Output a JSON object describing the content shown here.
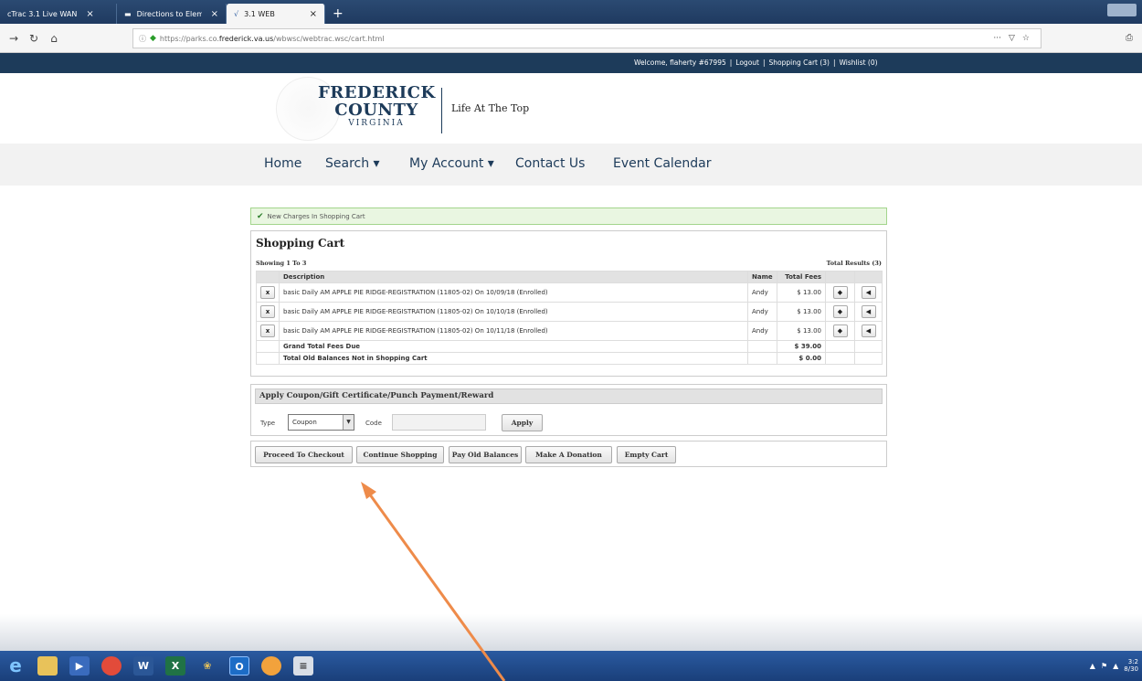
{
  "browser": {
    "tabs": [
      {
        "title": "cTrac 3.1 Live WAN"
      },
      {
        "title": "Directions to Elementary, Midd"
      },
      {
        "title": "3.1 WEB",
        "active": true
      }
    ],
    "url_prefix": "https://parks.co.",
    "url_domain": "frederick.va.us",
    "url_path": "/wbwsc/webtrac.wsc/cart.html",
    "more": "···"
  },
  "topbar": {
    "welcome": "Welcome, flaherty #67995",
    "logout": "Logout",
    "cart": "Shopping Cart (3)",
    "wishlist": "Wishlist (0)"
  },
  "brand": {
    "line1": "FREDERICK",
    "line2": "COUNTY",
    "line3": "VIRGINIA",
    "tagline": "Life At The Top"
  },
  "nav": {
    "home": "Home",
    "search": "Search ▾",
    "account": "My Account ▾",
    "contact": "Contact Us",
    "calendar": "Event Calendar"
  },
  "alert": "New Charges In Shopping Cart",
  "cart": {
    "title": "Shopping Cart",
    "showing": "Showing 1 To 3",
    "total_results": "Total Results (3)",
    "headers": {
      "description": "Description",
      "name": "Name",
      "fees": "Total Fees"
    },
    "rows": [
      {
        "remove": "x",
        "description": "basic Daily AM APPLE PIE RIDGE-REGISTRATION (11805-02) On 10/09/18 (Enrolled)",
        "name": "Andy",
        "fee": "$ 13.00"
      },
      {
        "remove": "x",
        "description": "basic Daily AM APPLE PIE RIDGE-REGISTRATION (11805-02) On 10/10/18 (Enrolled)",
        "name": "Andy",
        "fee": "$ 13.00"
      },
      {
        "remove": "x",
        "description": "basic Daily AM APPLE PIE RIDGE-REGISTRATION (11805-02) On 10/11/18 (Enrolled)",
        "name": "Andy",
        "fee": "$ 13.00"
      }
    ],
    "grand_total_label": "Grand Total Fees Due",
    "grand_total": "$ 39.00",
    "old_balance_label": "Total Old Balances Not in Shopping Cart",
    "old_balance": "$ 0.00"
  },
  "coupon": {
    "header": "Apply Coupon/Gift Certificate/Punch Payment/Reward",
    "type_label": "Type",
    "type_value": "Coupon",
    "code_label": "Code",
    "code_value": "",
    "apply": "Apply"
  },
  "actions": {
    "checkout": "Proceed To Checkout",
    "continue": "Continue Shopping",
    "pay_old": "Pay Old Balances",
    "donate": "Make A Donation",
    "empty": "Empty Cart"
  },
  "colors": {
    "brand_navy": "#1d3b5a",
    "annotation_arrow": "#ee8b4a",
    "alert_green": "#e9f6e1"
  },
  "taskbar": {
    "clock_time": "3:2",
    "clock_date": "8/30"
  }
}
